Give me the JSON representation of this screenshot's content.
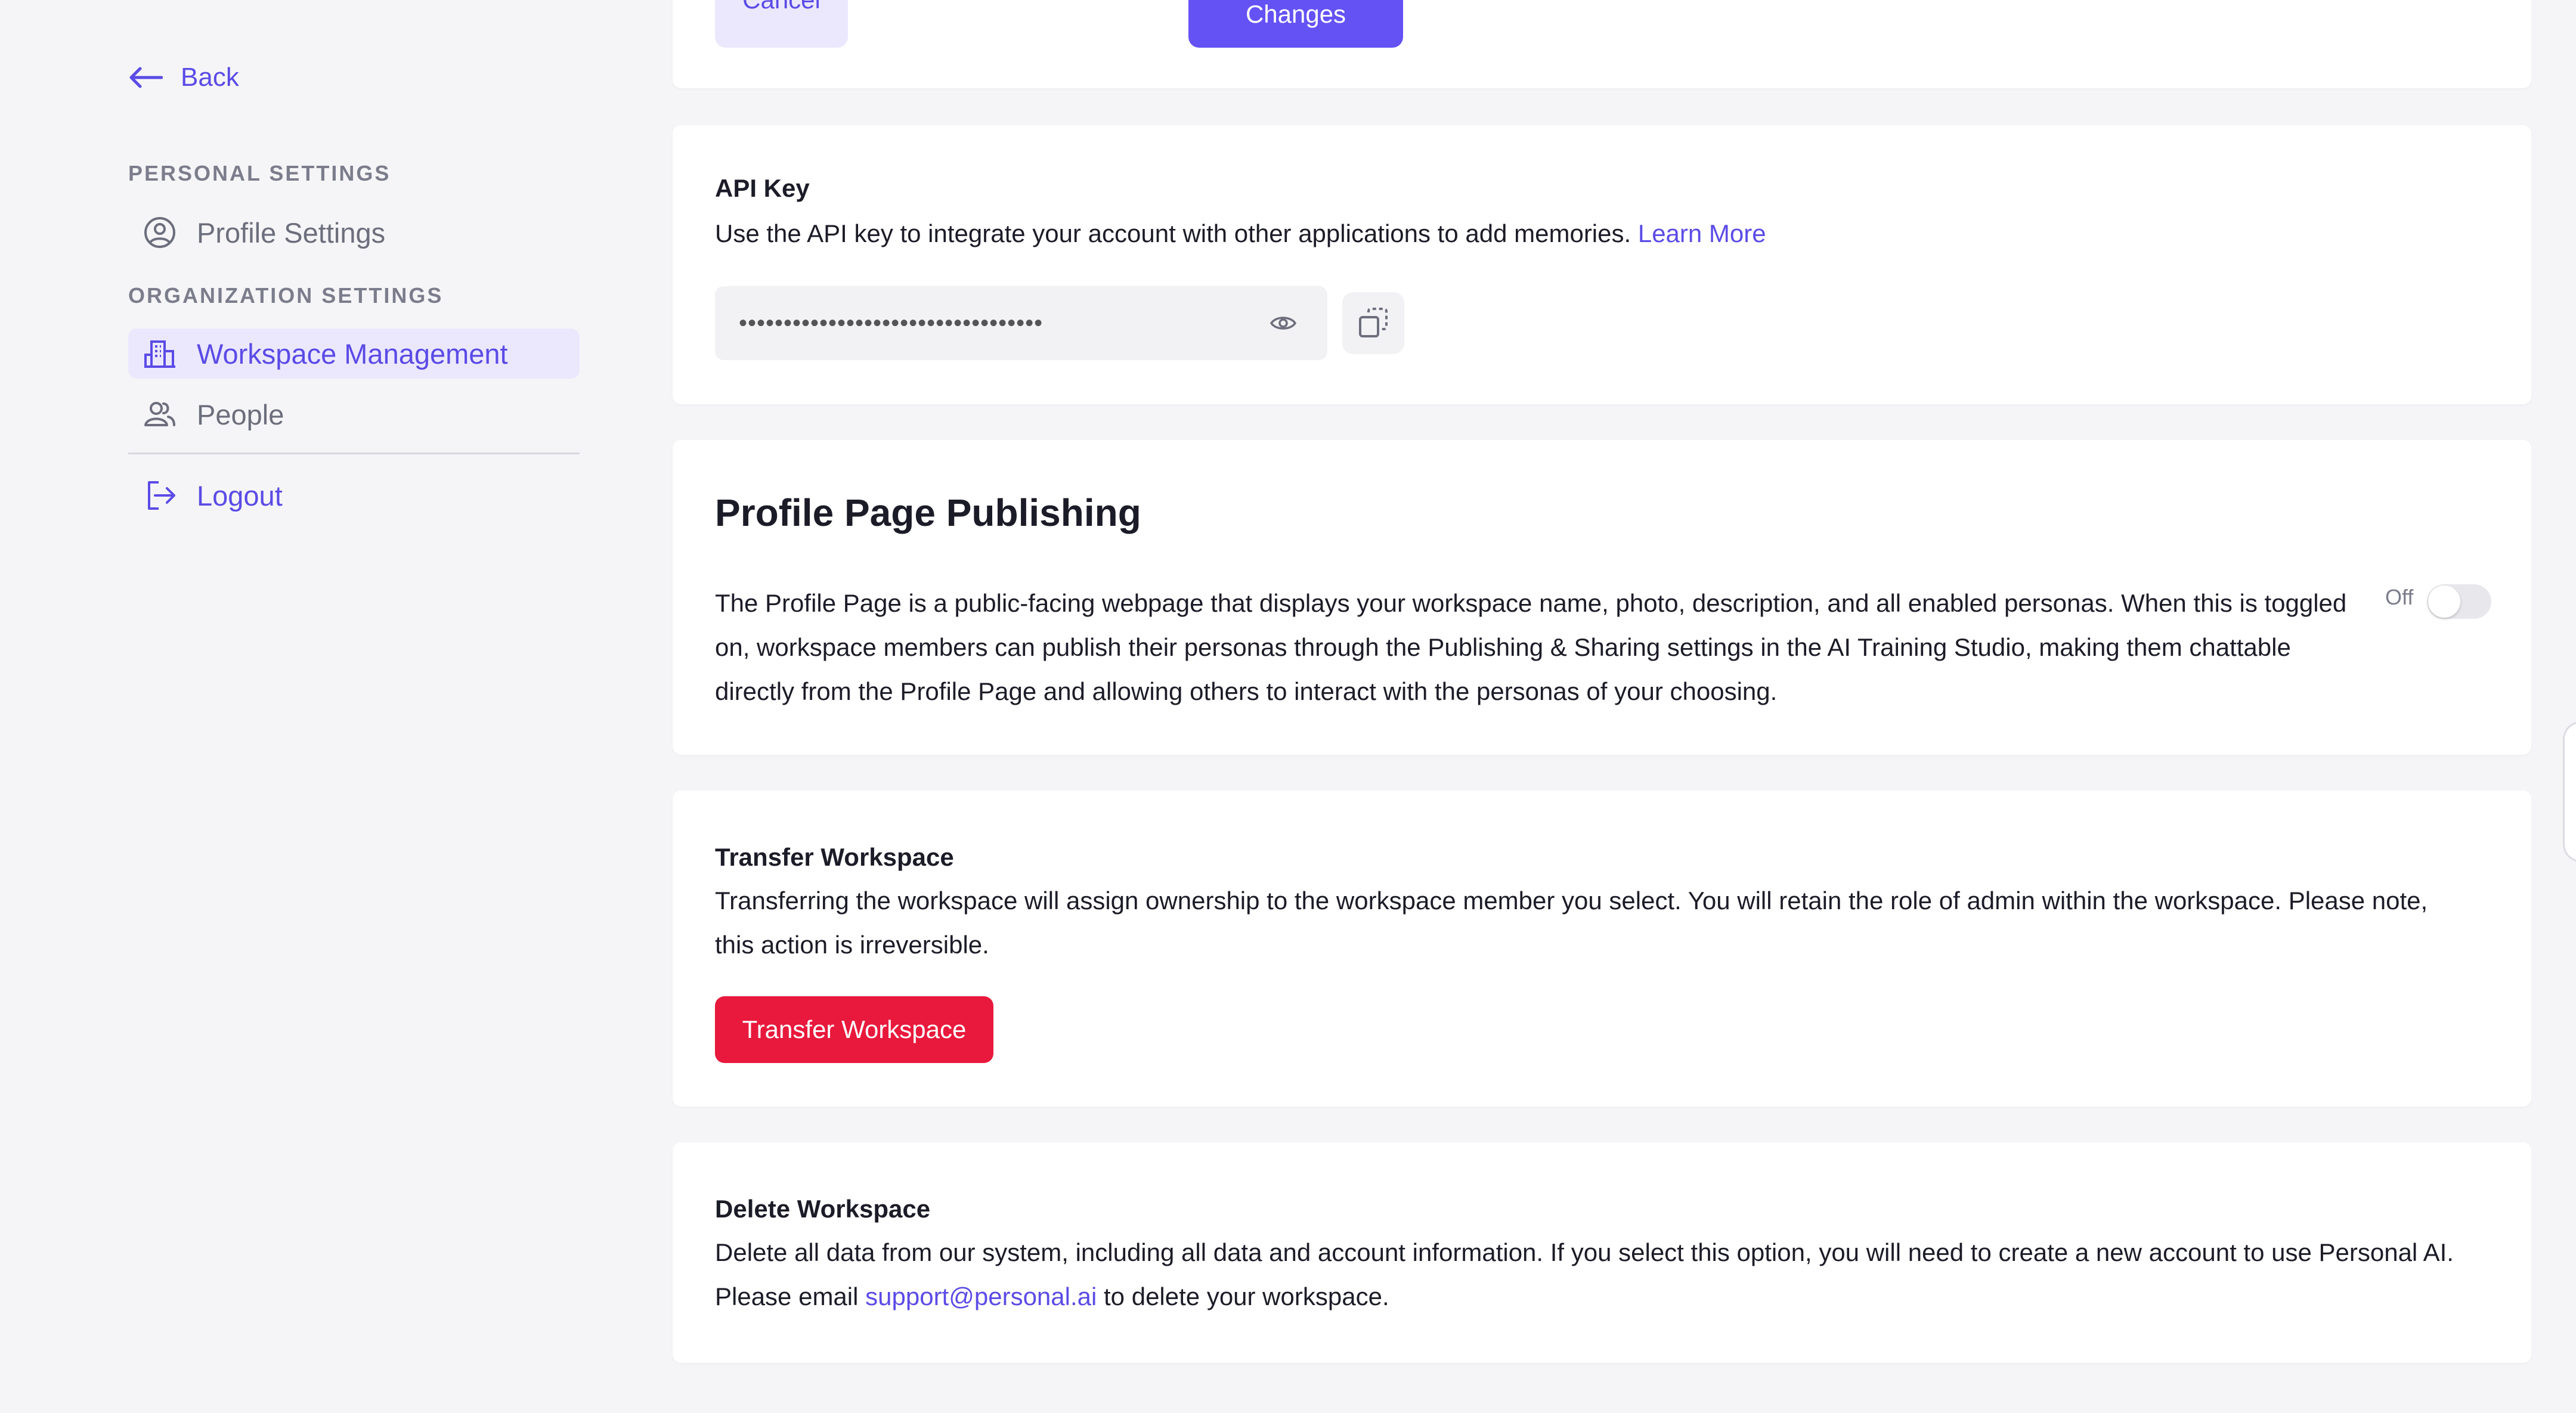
{
  "sidebar": {
    "back_label": "Back",
    "personal_section": "PERSONAL SETTINGS",
    "organization_section": "ORGANIZATION SETTINGS",
    "items": [
      {
        "label": "Profile Settings",
        "icon": "user-circle-icon"
      },
      {
        "label": "Workspace Management",
        "icon": "building-icon",
        "active": true
      },
      {
        "label": "People",
        "icon": "users-icon"
      }
    ],
    "logout_label": "Logout"
  },
  "top_actions": {
    "cancel_label": "Cancel",
    "save_label": "Save Changes"
  },
  "api_key": {
    "title": "API Key",
    "description": "Use the API key to integrate your account with other applications to add memories.",
    "learn_more": "Learn More",
    "masked_value": "••••••••••••••••••••••••••••••••••"
  },
  "publishing": {
    "title": "Profile Page Publishing",
    "description": "The Profile Page is a public-facing webpage that displays your workspace name, photo, description, and all enabled personas. When this is toggled on, workspace members can publish their personas through the Publishing & Sharing settings in the AI Training Studio, making them chattable directly from the Profile Page and allowing others to interact with the personas of your choosing.",
    "toggle_label": "Off",
    "toggle_on": false
  },
  "transfer": {
    "title": "Transfer Workspace",
    "description": "Transferring the workspace will assign ownership to the workspace member you select. You will retain the role of admin within the workspace. Please note, this action is irreversible.",
    "button_label": "Transfer Workspace"
  },
  "delete": {
    "title": "Delete Workspace",
    "description_1": "Delete all data from our system, including all data and account information. If you select this option, you will need to create a new account to use Personal AI.",
    "email_prefix": "Please email",
    "email": "support@personal.ai",
    "email_suffix": "to delete your workspace."
  },
  "colors": {
    "accent": "#5b4be6",
    "primary_button": "#6452f5",
    "danger": "#e8193c",
    "background": "#f5f5f7"
  }
}
